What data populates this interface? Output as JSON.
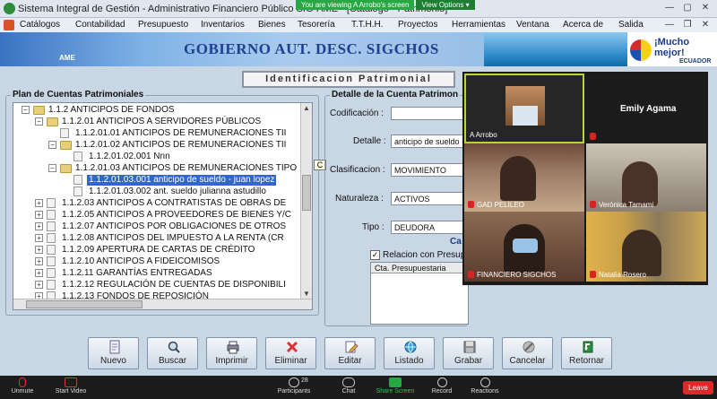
{
  "window": {
    "title": "Sistema Integral de Gestión - Administrativo Financiero Público SIG-AME - [Catálogo - Patrimonio]",
    "viewing_banner": "You are viewing A Arrobo's screen",
    "view_options": "View Options ▾"
  },
  "menu": [
    "Catálogos",
    "Contabilidad",
    "Presupuesto",
    "Inventarios",
    "Bienes",
    "Tesorería",
    "T.T.H.H.",
    "Proyectos",
    "Herramientas",
    "Ventana",
    "Acerca de",
    "Salida"
  ],
  "banner": {
    "title": "GOBIERNO AUT. DESC. SIGCHOS",
    "ame": "AME",
    "muchomejor_1": "¡Mucho",
    "muchomejor_2": "mejor!",
    "muchomejor_3": "ECUADOR"
  },
  "section_title": "Identificacion Patrimonial",
  "plan_panel": {
    "label": "Plan de Cuentas Patrimoniales",
    "tree": [
      {
        "text": "1.1.2 ANTICIPOS DE FONDOS",
        "level": 0,
        "node": "minus",
        "icon": "folder"
      },
      {
        "text": "1.1.2.01 ANTICIPOS A SERVIDORES PÚBLICOS",
        "level": 1,
        "node": "minus",
        "icon": "folder"
      },
      {
        "text": "1.1.2.01.01 ANTICIPOS DE REMUNERACIONES TII",
        "level": 2,
        "node": "none",
        "icon": "doc"
      },
      {
        "text": "1.1.2.01.02 ANTICIPOS DE REMUNERACIONES TII",
        "level": 2,
        "node": "minus",
        "icon": "folder"
      },
      {
        "text": "1.1.2.01.02.001 Nnn",
        "level": 3,
        "node": "none",
        "icon": "doc"
      },
      {
        "text": "1.1.2.01.03 ANTICIPOS DE REMUNERACIONES TIPO",
        "level": 2,
        "node": "minus",
        "icon": "folder"
      },
      {
        "text": "1.1.2.01.03.001 anticipo de sueldo - juan lopez",
        "level": 3,
        "node": "none",
        "icon": "doc",
        "selected": true
      },
      {
        "text": "1.1.2.01.03.002 ant. sueldo julianna astudillo",
        "level": 3,
        "node": "none",
        "icon": "doc"
      },
      {
        "text": "1.1.2.03 ANTICIPOS A CONTRATISTAS DE OBRAS DE",
        "level": 1,
        "node": "plus",
        "icon": "doc"
      },
      {
        "text": "1.1.2.05 ANTICIPOS A PROVEEDORES DE BIENES Y/C",
        "level": 1,
        "node": "plus",
        "icon": "doc"
      },
      {
        "text": "1.1.2.07 ANTICIPOS POR OBLIGACIONES DE OTROS",
        "level": 1,
        "node": "plus",
        "icon": "doc"
      },
      {
        "text": "1.1.2.08 ANTICIPOS DEL IMPUESTO A LA RENTA (CR",
        "level": 1,
        "node": "plus",
        "icon": "doc"
      },
      {
        "text": "1.1.2.09 APERTURA DE CARTAS DE CRÉDITO",
        "level": 1,
        "node": "plus",
        "icon": "doc"
      },
      {
        "text": "1.1.2.10 ANTICIPOS A FIDEICOMISOS",
        "level": 1,
        "node": "plus",
        "icon": "doc"
      },
      {
        "text": "1.1.2.11 GARANTÍAS ENTREGADAS",
        "level": 1,
        "node": "plus",
        "icon": "doc"
      },
      {
        "text": "1.1.2.12 REGULACIÓN DE CUENTAS DE DISPONIBILI",
        "level": 1,
        "node": "plus",
        "icon": "doc"
      },
      {
        "text": "1.1.2.13 FONDOS DE REPOSICIÓN",
        "level": 1,
        "node": "plus",
        "icon": "doc"
      }
    ],
    "tooltip": "C"
  },
  "detail_panel": {
    "label": "Detalle de la Cuenta Patrimon",
    "codificacion_label": "Codificación :",
    "codificacion_value": "",
    "detalle_label": "Detalle :",
    "detalle_value": "anticipo de sueldo - ju",
    "clasificacion_label": "Clasificacion :",
    "clasificacion_value": "MOVIMIENTO",
    "naturaleza_label": "Naturaleza :",
    "naturaleza_value": "ACTIVOS",
    "tipo_label": "Tipo :",
    "tipo_value": "DEUDORA",
    "cr_label": "Ca",
    "relacion_label": "Relacion con Presupue",
    "relacion_checked": "✓",
    "cta_header": "Cta. Presupuestaria"
  },
  "buttons": {
    "nuevo": "Nuevo",
    "buscar": "Buscar",
    "imprimir": "Imprimir",
    "eliminar": "Eliminar",
    "editar": "Editar",
    "listado": "Listado",
    "grabar": "Grabar",
    "cancelar": "Cancelar",
    "retornar": "Retornar"
  },
  "participants": {
    "a_arrobo": "A Arrobo",
    "emily": "Emily Agama",
    "gad": "GAD PELILEO",
    "veronica": "Verónica Tamami",
    "financiero": "FINANCIERO SIGCHOS",
    "natalia": "Natalia Rosero"
  },
  "zoom_toolbar": {
    "unmute": "Unmute",
    "start_video": "Start Video",
    "participants": "Participants",
    "participants_count": "28",
    "chat": "Chat",
    "share_screen": "Share Screen",
    "record": "Record",
    "reactions": "Reactions",
    "leave": "Leave"
  },
  "colors": {
    "selection": "#3366cc",
    "share_green": "#27a844",
    "leave_red": "#e02828"
  }
}
